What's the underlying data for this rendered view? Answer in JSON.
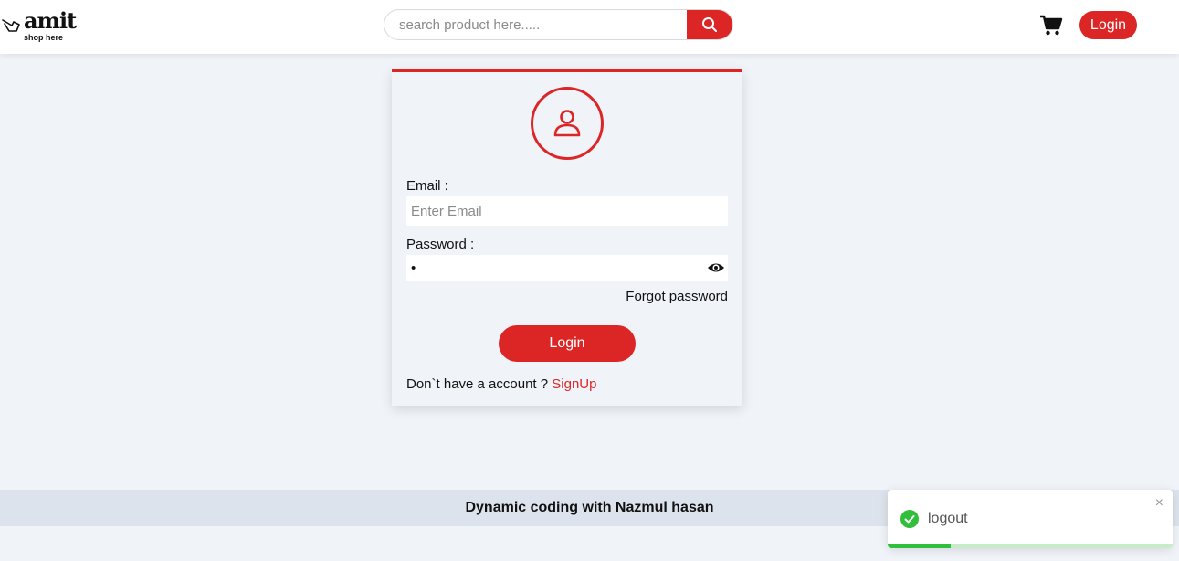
{
  "header": {
    "logo_text": "amit",
    "logo_tagline": "shop here",
    "search_placeholder": "search product here.....",
    "login_label": "Login"
  },
  "login_card": {
    "email_label": "Email :",
    "email_placeholder": "Enter Email",
    "password_label": "Password :",
    "password_value": "•",
    "forgot_label": "Forgot password",
    "submit_label": "Login",
    "no_account_text": "Don`t have a account ?",
    "signup_label": "SignUp"
  },
  "footer": {
    "text": "Dynamic coding with Nazmul hasan"
  },
  "toast": {
    "message": "logout",
    "close_symbol": "×",
    "progress": 0.22
  },
  "colors": {
    "accent": "#dc2626",
    "page_bg": "#f0f3f8",
    "footer_bg": "#dde3ec",
    "success": "#2fbf3a"
  },
  "icons": [
    "hand-pointer-icon",
    "search-icon",
    "cart-icon",
    "user-icon",
    "eye-icon",
    "check-circle-icon",
    "close-icon"
  ]
}
